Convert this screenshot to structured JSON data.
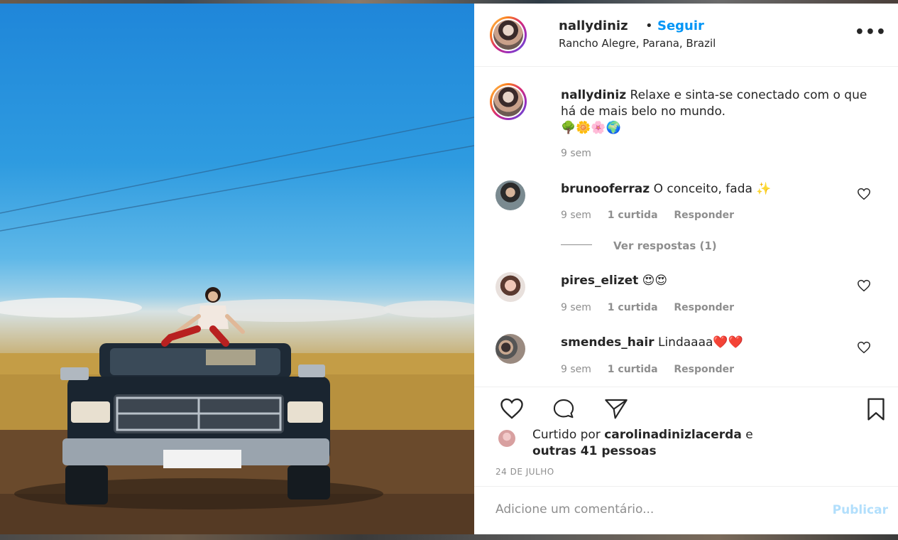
{
  "post": {
    "username": "nallydiniz",
    "dot": "•",
    "follow_label": "Seguir",
    "location": "Rancho Alegre, Parana, Brazil",
    "more_icon": "more-options-icon",
    "more_glyph": "•••"
  },
  "caption": {
    "username": "nallydiniz",
    "text": "Relaxe e sinta-se conectado com o que há de mais belo no mundo.",
    "emojis": "🌳🌼🌸🌍",
    "time": "9 sem"
  },
  "comments": [
    {
      "username": "brunooferraz",
      "text": "O conceito, fada ✨",
      "time": "9 sem",
      "likes": "1 curtida",
      "reply": "Responder"
    },
    {
      "username": "pires_elizet",
      "text": "😍😍",
      "time": "9 sem",
      "likes": "1 curtida",
      "reply": "Responder"
    },
    {
      "username": "smendes_hair",
      "text": "Lindaaaa❤️❤️",
      "time": "9 sem",
      "likes": "1 curtida",
      "reply": "Responder"
    }
  ],
  "view_replies": "Ver respostas (1)",
  "likes": {
    "prefix": "Curtido por",
    "user": "carolinadinizlacerda",
    "suffix": "e",
    "others": "outras 41 pessoas"
  },
  "date": "24 DE JULHO",
  "add_comment": {
    "placeholder": "Adicione um comentário...",
    "publish_label": "Publicar"
  },
  "colors": {
    "accent": "#0095f6",
    "publish_disabled": "#b2dffc",
    "muted": "#8e8e8e"
  }
}
